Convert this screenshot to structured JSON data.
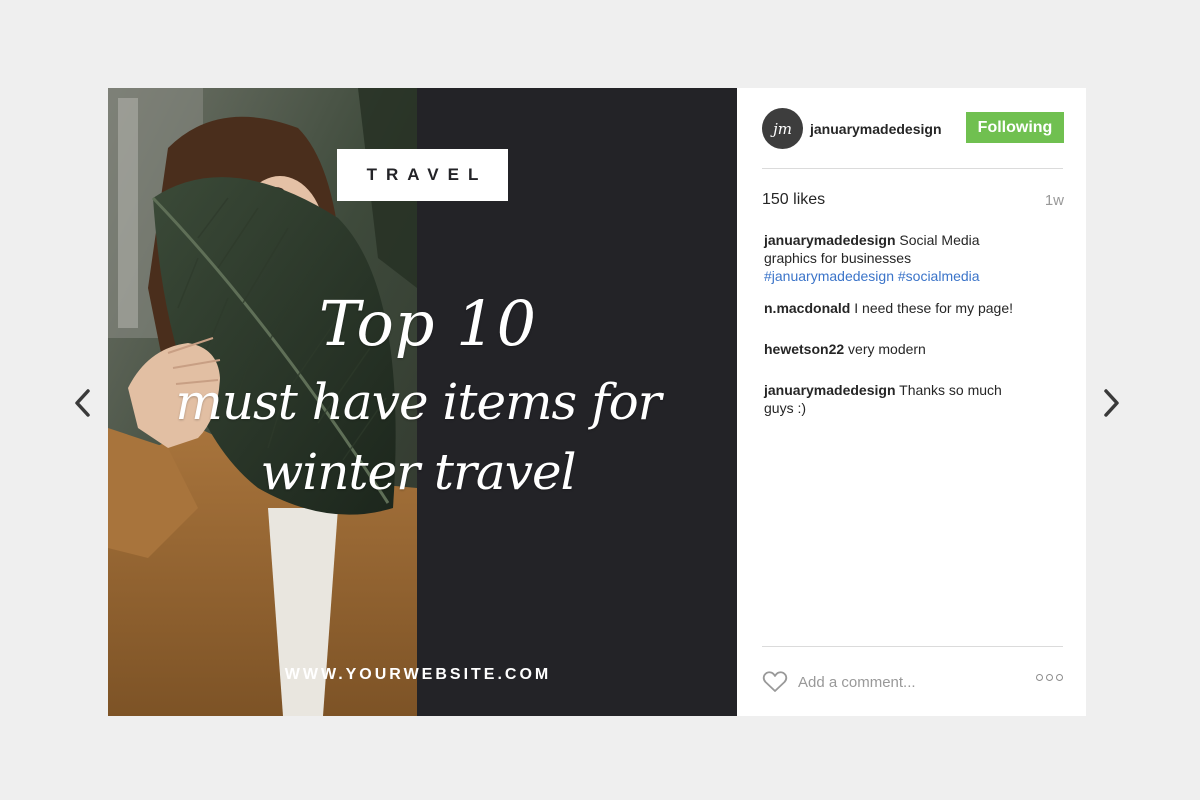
{
  "post": {
    "category": "TRAVEL",
    "headline": {
      "line1": "Top 10",
      "line2": "must have items for",
      "line3": "winter travel"
    },
    "website": "WWW.YOURWEBSITE.COM"
  },
  "sidebar": {
    "avatar_text": "jm",
    "username": "januarymadedesign",
    "follow_label": "Following",
    "likes": "150 likes",
    "time": "1w",
    "comments": [
      {
        "user": "januarymadedesign",
        "text": " Social Media graphics for businesses",
        "hashtags": "#januarymadedesign #socialmedia"
      },
      {
        "user": "n.macdonald",
        "text": " I need these for my page!"
      },
      {
        "user": "hewetson22",
        "text": " very modern"
      },
      {
        "user": "januarymadedesign",
        "text": " Thanks so much guys :)"
      }
    ],
    "comment_placeholder": "Add a comment..."
  },
  "icons": {
    "prev": "chevron-left-icon",
    "next": "chevron-right-icon",
    "like": "heart-icon",
    "more": "more-options-icon"
  },
  "colors": {
    "background": "#efefef",
    "dark_panel": "#232327",
    "follow_button": "#70c050",
    "hashtag": "#3b74c9"
  }
}
